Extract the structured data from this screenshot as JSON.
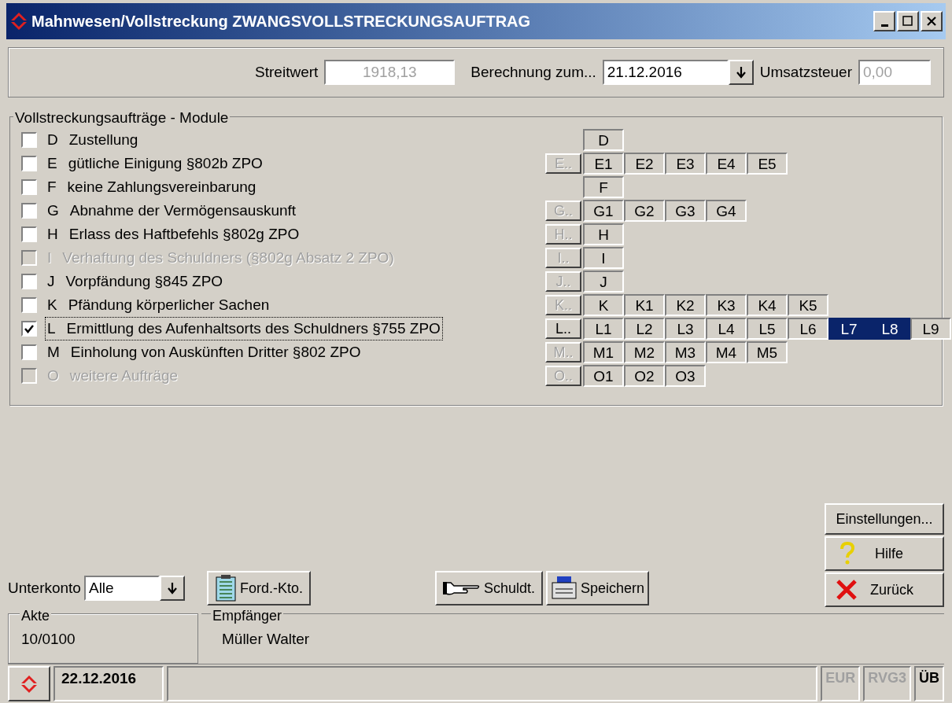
{
  "window": {
    "title": "Mahnwesen/Vollstreckung ZWANGSVOLLSTRECKUNGSAUFTRAG"
  },
  "header": {
    "streitwert_label": "Streitwert",
    "streitwert": "1918,13",
    "berechnung_label": "Berechnung zum...",
    "berechnung": "21.12.2016",
    "umsatzsteuer_label": "Umsatzsteuer",
    "umsatzsteuer": "0,00"
  },
  "modules": {
    "title": "Vollstreckungsaufträge - Module",
    "rows": [
      {
        "letter": "D",
        "label": "Zustellung",
        "checked": false,
        "disabled": false,
        "focused": false,
        "buttons": [
          {
            "label": "D",
            "selected": false
          }
        ]
      },
      {
        "letter": "E",
        "label": "gütliche Einigung §802b ZPO",
        "checked": false,
        "disabled": false,
        "focused": false,
        "group_button": {
          "label": "E..",
          "disabled": true
        },
        "buttons": [
          {
            "label": "E1",
            "selected": false
          },
          {
            "label": "E2",
            "selected": false
          },
          {
            "label": "E3",
            "selected": false
          },
          {
            "label": "E4",
            "selected": false
          },
          {
            "label": "E5",
            "selected": false
          }
        ]
      },
      {
        "letter": "F",
        "label": "keine Zahlungsvereinbarung",
        "checked": false,
        "disabled": false,
        "focused": false,
        "buttons": [
          {
            "label": "F",
            "selected": false
          }
        ]
      },
      {
        "letter": "G",
        "label": "Abnahme der Vermögensauskunft",
        "checked": false,
        "disabled": false,
        "focused": false,
        "group_button": {
          "label": "G..",
          "disabled": true
        },
        "buttons": [
          {
            "label": "G1",
            "selected": false
          },
          {
            "label": "G2",
            "selected": false
          },
          {
            "label": "G3",
            "selected": false
          },
          {
            "label": "G4",
            "selected": false
          }
        ]
      },
      {
        "letter": "H",
        "label": "Erlass des Haftbefehls §802g ZPO",
        "checked": false,
        "disabled": false,
        "focused": false,
        "group_button": {
          "label": "H..",
          "disabled": true
        },
        "buttons": [
          {
            "label": "H",
            "selected": false
          }
        ]
      },
      {
        "letter": "I",
        "label": "Verhaftung des Schuldners (§802g Absatz 2 ZPO)",
        "checked": false,
        "disabled": true,
        "focused": false,
        "group_button": {
          "label": "I..",
          "disabled": true
        },
        "buttons": [
          {
            "label": "I",
            "selected": false
          }
        ]
      },
      {
        "letter": "J",
        "label": "Vorpfändung §845 ZPO",
        "checked": false,
        "disabled": false,
        "focused": false,
        "group_button": {
          "label": "J..",
          "disabled": true
        },
        "buttons": [
          {
            "label": "J",
            "selected": false
          }
        ]
      },
      {
        "letter": "K",
        "label": "Pfändung körperlicher Sachen",
        "checked": false,
        "disabled": false,
        "focused": false,
        "group_button": {
          "label": "K..",
          "disabled": true
        },
        "buttons": [
          {
            "label": "K",
            "selected": false
          },
          {
            "label": "K1",
            "selected": false
          },
          {
            "label": "K2",
            "selected": false
          },
          {
            "label": "K3",
            "selected": false
          },
          {
            "label": "K4",
            "selected": false
          },
          {
            "label": "K5",
            "selected": false
          }
        ]
      },
      {
        "letter": "L",
        "label": "Ermittlung des Aufenhaltsorts des Schuldners §755 ZPO",
        "checked": true,
        "disabled": false,
        "focused": true,
        "group_button": {
          "label": "L..",
          "disabled": false
        },
        "buttons": [
          {
            "label": "L1",
            "selected": false
          },
          {
            "label": "L2",
            "selected": false
          },
          {
            "label": "L3",
            "selected": false
          },
          {
            "label": "L4",
            "selected": false
          },
          {
            "label": "L5",
            "selected": false
          },
          {
            "label": "L6",
            "selected": false
          },
          {
            "label": "L7",
            "selected": true
          },
          {
            "label": "L8",
            "selected": true
          },
          {
            "label": "L9",
            "selected": false
          }
        ]
      },
      {
        "letter": "M",
        "label": "Einholung von Auskünften Dritter §802 ZPO",
        "checked": false,
        "disabled": false,
        "focused": false,
        "group_button": {
          "label": "M..",
          "disabled": true
        },
        "buttons": [
          {
            "label": "M1",
            "selected": false
          },
          {
            "label": "M2",
            "selected": false
          },
          {
            "label": "M3",
            "selected": false
          },
          {
            "label": "M4",
            "selected": false
          },
          {
            "label": "M5",
            "selected": false
          }
        ]
      },
      {
        "letter": "O",
        "label": "weitere Aufträge",
        "checked": false,
        "disabled": true,
        "focused": false,
        "group_button": {
          "label": "O..",
          "disabled": true
        },
        "buttons": [
          {
            "label": "O1",
            "selected": false
          },
          {
            "label": "O2",
            "selected": false
          },
          {
            "label": "O3",
            "selected": false
          }
        ]
      }
    ]
  },
  "side_buttons": {
    "einstellungen": "Einstellungen...",
    "hilfe": "Hilfe",
    "zurueck": "Zurück"
  },
  "toolbar": {
    "unterkonto_label": "Unterkonto",
    "unterkonto": "Alle",
    "ford_kto": "Ford.-Kto.",
    "schuldt": "Schuldt.",
    "speichern": "Speichern"
  },
  "info": {
    "akte_label": "Akte",
    "akte": "10/0100",
    "empfaenger_label": "Empfänger",
    "empfaenger": "Müller Walter"
  },
  "status_bar": {
    "date": "22.12.2016",
    "indicators": [
      {
        "label": "EUR",
        "disabled": true
      },
      {
        "label": "RVG3",
        "disabled": true
      },
      {
        "label": "ÜB",
        "disabled": false
      }
    ]
  }
}
